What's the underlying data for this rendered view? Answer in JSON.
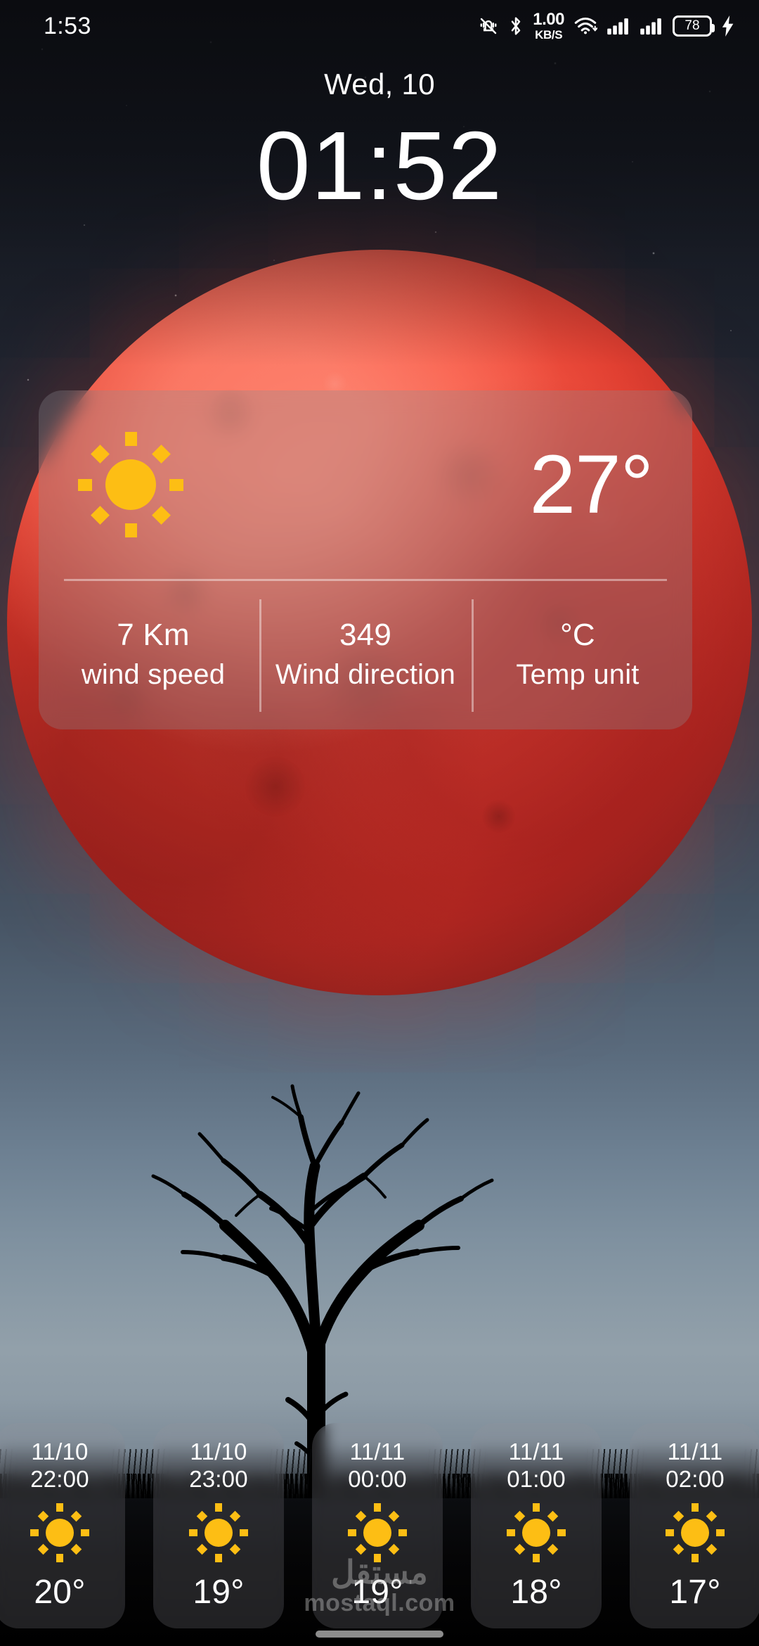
{
  "status_bar": {
    "time": "1:53",
    "icons": [
      "vibrate-off-icon",
      "bluetooth-icon",
      "wifi-icon",
      "signal-sim1-icon",
      "signal-sim2-icon"
    ],
    "network_speed_value": "1.00",
    "network_speed_unit": "KB/S",
    "battery_percent": "78",
    "charging": true
  },
  "clock": {
    "date": "Wed, 10",
    "time": "01:52"
  },
  "weather_widget": {
    "condition_icon": "sun-icon",
    "temperature": "27°",
    "stats": [
      {
        "value": "7 Km",
        "label": "wind speed"
      },
      {
        "value": "349",
        "label": "Wind direction"
      },
      {
        "value": "°C",
        "label": "Temp unit"
      }
    ]
  },
  "hourly_forecast": [
    {
      "date": "11/10",
      "time": "22:00",
      "icon": "sun-icon",
      "temp": "20°"
    },
    {
      "date": "11/10",
      "time": "23:00",
      "icon": "sun-icon",
      "temp": "19°"
    },
    {
      "date": "11/11",
      "time": "00:00",
      "icon": "sun-icon",
      "temp": "19°"
    },
    {
      "date": "11/11",
      "time": "01:00",
      "icon": "sun-icon",
      "temp": "18°"
    },
    {
      "date": "11/11",
      "time": "02:00",
      "icon": "sun-icon",
      "temp": "17°"
    }
  ],
  "watermark": {
    "arabic": "مستقل",
    "latin": "mostaql.com"
  },
  "colors": {
    "sun_yellow": "#FDBE14",
    "moon_red": "#E8412F",
    "text_primary": "#FFFFFF"
  }
}
